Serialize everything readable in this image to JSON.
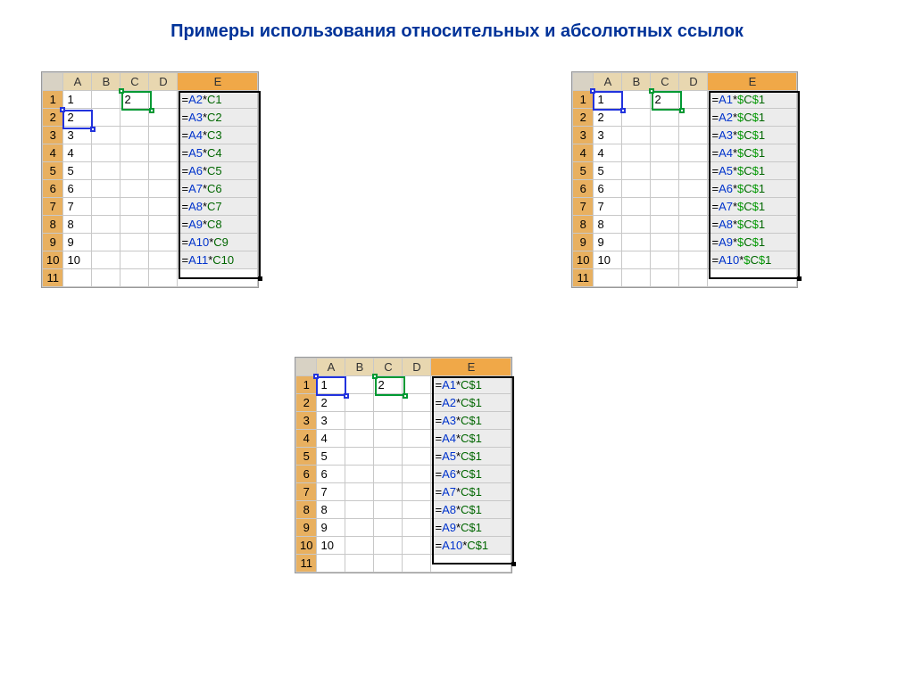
{
  "title": "Примеры использования относительных и абсолютных ссылок",
  "columns": [
    "A",
    "B",
    "C",
    "D",
    "E"
  ],
  "tables": {
    "relative": {
      "rows": [
        {
          "n": "1",
          "A": "1",
          "C": "2",
          "E_pre": "=",
          "E_a": "A2",
          "E_mid": "*",
          "E_c": "C1"
        },
        {
          "n": "2",
          "A": "2",
          "C": "",
          "E_pre": "=",
          "E_a": "A3",
          "E_mid": "*",
          "E_c": "C2"
        },
        {
          "n": "3",
          "A": "3",
          "C": "",
          "E_pre": "=",
          "E_a": "A4",
          "E_mid": "*",
          "E_c": "C3"
        },
        {
          "n": "4",
          "A": "4",
          "C": "",
          "E_pre": "=",
          "E_a": "A5",
          "E_mid": "*",
          "E_c": "C4"
        },
        {
          "n": "5",
          "A": "5",
          "C": "",
          "E_pre": "=",
          "E_a": "A6",
          "E_mid": "*",
          "E_c": "C5"
        },
        {
          "n": "6",
          "A": "6",
          "C": "",
          "E_pre": "=",
          "E_a": "A7",
          "E_mid": "*",
          "E_c": "C6"
        },
        {
          "n": "7",
          "A": "7",
          "C": "",
          "E_pre": "=",
          "E_a": "A8",
          "E_mid": "*",
          "E_c": "C7"
        },
        {
          "n": "8",
          "A": "8",
          "C": "",
          "E_pre": "=",
          "E_a": "A9",
          "E_mid": "*",
          "E_c": "C8"
        },
        {
          "n": "9",
          "A": "9",
          "C": "",
          "E_pre": "=",
          "E_a": "A10",
          "E_mid": "*",
          "E_c": "C9"
        },
        {
          "n": "10",
          "A": "10",
          "C": "",
          "E_pre": "=",
          "E_a": "A11",
          "E_mid": "*",
          "E_c": "C10"
        }
      ],
      "tail": "11"
    },
    "absolute": {
      "rows": [
        {
          "n": "1",
          "A": "1",
          "C": "2",
          "E_pre": "=",
          "E_a": "A1",
          "E_mid": "*",
          "E_c": "$C$1"
        },
        {
          "n": "2",
          "A": "2",
          "C": "",
          "E_pre": "=",
          "E_a": "A2",
          "E_mid": "*",
          "E_c": "$C$1"
        },
        {
          "n": "3",
          "A": "3",
          "C": "",
          "E_pre": "=",
          "E_a": "A3",
          "E_mid": "*",
          "E_c": "$C$1"
        },
        {
          "n": "4",
          "A": "4",
          "C": "",
          "E_pre": "=",
          "E_a": "A4",
          "E_mid": "*",
          "E_c": "$C$1"
        },
        {
          "n": "5",
          "A": "5",
          "C": "",
          "E_pre": "=",
          "E_a": "A5",
          "E_mid": "*",
          "E_c": "$C$1"
        },
        {
          "n": "6",
          "A": "6",
          "C": "",
          "E_pre": "=",
          "E_a": "A6",
          "E_mid": "*",
          "E_c": "$C$1"
        },
        {
          "n": "7",
          "A": "7",
          "C": "",
          "E_pre": "=",
          "E_a": "A7",
          "E_mid": "*",
          "E_c": "$C$1"
        },
        {
          "n": "8",
          "A": "8",
          "C": "",
          "E_pre": "=",
          "E_a": "A8",
          "E_mid": "*",
          "E_c": "$C$1"
        },
        {
          "n": "9",
          "A": "9",
          "C": "",
          "E_pre": "=",
          "E_a": "A9",
          "E_mid": "*",
          "E_c": "$C$1"
        },
        {
          "n": "10",
          "A": "10",
          "C": "",
          "E_pre": "=",
          "E_a": "A10",
          "E_mid": "*",
          "E_c": "$C$1"
        }
      ],
      "tail": "11"
    },
    "mixed": {
      "rows": [
        {
          "n": "1",
          "A": "1",
          "C": "2",
          "E_pre": "=",
          "E_a": "A1",
          "E_mid": "*",
          "E_c": "C$1"
        },
        {
          "n": "2",
          "A": "2",
          "C": "",
          "E_pre": "=",
          "E_a": "A2",
          "E_mid": "*",
          "E_c": "C$1"
        },
        {
          "n": "3",
          "A": "3",
          "C": "",
          "E_pre": "=",
          "E_a": "A3",
          "E_mid": "*",
          "E_c": "C$1"
        },
        {
          "n": "4",
          "A": "4",
          "C": "",
          "E_pre": "=",
          "E_a": "A4",
          "E_mid": "*",
          "E_c": "C$1"
        },
        {
          "n": "5",
          "A": "5",
          "C": "",
          "E_pre": "=",
          "E_a": "A5",
          "E_mid": "*",
          "E_c": "C$1"
        },
        {
          "n": "6",
          "A": "6",
          "C": "",
          "E_pre": "=",
          "E_a": "A6",
          "E_mid": "*",
          "E_c": "C$1"
        },
        {
          "n": "7",
          "A": "7",
          "C": "",
          "E_pre": "=",
          "E_a": "A7",
          "E_mid": "*",
          "E_c": "C$1"
        },
        {
          "n": "8",
          "A": "8",
          "C": "",
          "E_pre": "=",
          "E_a": "A8",
          "E_mid": "*",
          "E_c": "C$1"
        },
        {
          "n": "9",
          "A": "9",
          "C": "",
          "E_pre": "=",
          "E_a": "A9",
          "E_mid": "*",
          "E_c": "C$1"
        },
        {
          "n": "10",
          "A": "10",
          "C": "",
          "E_pre": "=",
          "E_a": "A10",
          "E_mid": "*",
          "E_c": "C$1"
        }
      ],
      "tail": "11"
    }
  }
}
